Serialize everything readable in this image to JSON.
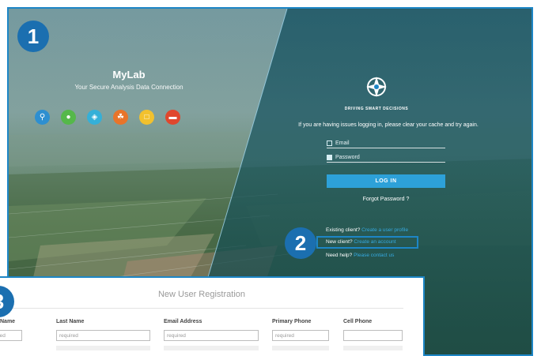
{
  "step_badges": {
    "one": "1",
    "two": "2",
    "three": "3"
  },
  "brand": {
    "name": "MyLab",
    "subtitle": "Your Secure Analysis Data Connection"
  },
  "apps": [
    {
      "icon": "microscope-icon",
      "color": "#2e8fd0"
    },
    {
      "icon": "leaf-icon",
      "color": "#55b84a"
    },
    {
      "icon": "water-drop-icon",
      "color": "#35b0d8"
    },
    {
      "icon": "plant-icon",
      "color": "#e8742a"
    },
    {
      "icon": "document-icon",
      "color": "#f2c12e"
    },
    {
      "icon": "bone-icon",
      "color": "#e0472d"
    }
  ],
  "login": {
    "tagline": "DRIVING SMART DECISIONS",
    "notice": "If you are having issues logging in, please clear your cache and try again.",
    "email_placeholder": "Email",
    "password_placeholder": "Password",
    "login_button": "LOG IN",
    "forgot_password": "Forgot Password ?",
    "existing_client_text": "Existing client?",
    "existing_client_link": "Create a user profile",
    "new_client_text": "New client?",
    "new_client_link": "Create an account",
    "need_help_text": "Need help?",
    "need_help_link": "Please contact us"
  },
  "registration": {
    "title": "New User Registration",
    "columns": [
      {
        "label": "Name",
        "placeholder": "ired"
      },
      {
        "label": "Last Name",
        "placeholder": "required"
      },
      {
        "label": "Email Address",
        "placeholder": "required"
      },
      {
        "label": "Primary Phone",
        "placeholder": "required"
      },
      {
        "label": "Cell Phone",
        "placeholder": ""
      }
    ]
  },
  "colors": {
    "accent": "#1d86c6",
    "badge": "#1b6fb0",
    "login_button": "#2da1d9",
    "link": "#35a9e0"
  }
}
